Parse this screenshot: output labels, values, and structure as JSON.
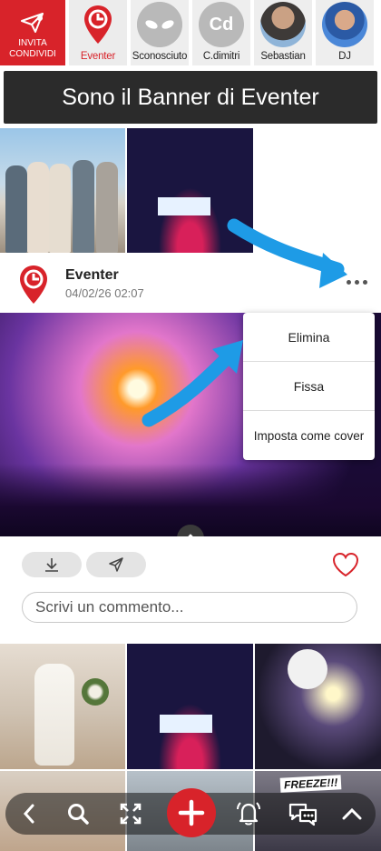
{
  "stories": {
    "invite_line1": "INVITA",
    "invite_line2": "CONDIVIDI",
    "items": [
      {
        "label": "Eventer",
        "active": true
      },
      {
        "label": "Sconosciuto"
      },
      {
        "label": "C.dimitri",
        "initials": "Cd"
      },
      {
        "label": "Sebastian"
      },
      {
        "label": "DJ"
      }
    ]
  },
  "banner": {
    "text": "Sono il Banner di Eventer"
  },
  "post": {
    "author": "Eventer",
    "timestamp": "04/02/26 02:07",
    "menu": [
      "Elimina",
      "Fissa",
      "Imposta come cover"
    ],
    "comment_placeholder": "Scrivi un commento..."
  },
  "grid": {
    "freeze_label": "FREEZE!!!"
  },
  "colors": {
    "brand_red": "#d8232a",
    "arrow_blue": "#1e9be6",
    "banner_bg": "#2b2b2b"
  },
  "icons": {
    "invite": "paper-plane-icon",
    "eventer": "location-pin-icon",
    "sconosciuto": "alien-icon",
    "menu": "more-dots-icon",
    "download": "download-icon",
    "share": "send-icon",
    "like": "heart-icon",
    "toolbar": [
      "chevron-left-icon",
      "search-icon",
      "expand-icon",
      "plus-icon",
      "bell-icon",
      "chat-icon",
      "chevron-up-icon"
    ]
  }
}
